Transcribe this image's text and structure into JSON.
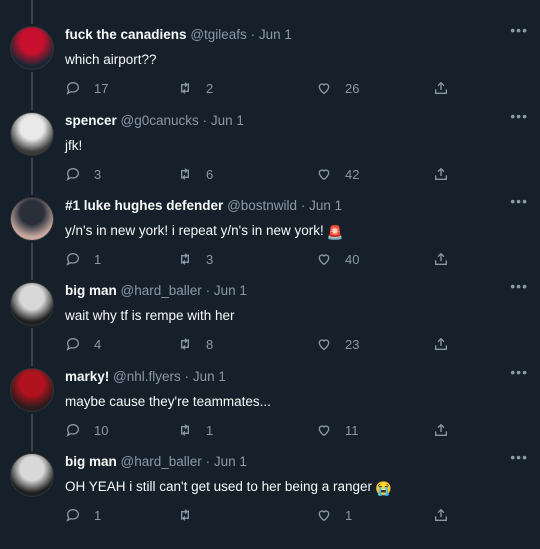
{
  "tweets": [
    {
      "name": "fuck the canadiens",
      "handle": "@tgileafs",
      "date": "Jun 1",
      "text": "which airport??",
      "replies": "17",
      "retweets": "2",
      "likes": "26",
      "avatar_colors": [
        "#c8102e",
        "#1b2633"
      ]
    },
    {
      "name": "spencer",
      "handle": "@g0canucks",
      "date": "Jun 1",
      "text": "jfk!",
      "replies": "3",
      "retweets": "6",
      "likes": "42",
      "avatar_colors": [
        "#e9e9e9",
        "#3a3a3a"
      ]
    },
    {
      "name": "#1 luke hughes defender",
      "handle": "@bostnwild",
      "date": "Jun 1",
      "text": "y/n's in new york! i repeat y/n's in new york!",
      "emoji": "🚨",
      "replies": "1",
      "retweets": "3",
      "likes": "40",
      "avatar_colors": [
        "#2a2f3a",
        "#c8a8a0"
      ]
    },
    {
      "name": "big man",
      "handle": "@hard_baller",
      "date": "Jun 1",
      "text": "wait why tf is rempe with her",
      "replies": "4",
      "retweets": "8",
      "likes": "23",
      "avatar_colors": [
        "#d8d8d8",
        "#1f1f1f"
      ]
    },
    {
      "name": "marky!",
      "handle": "@nhl.flyers",
      "date": "Jun 1",
      "text": "maybe cause they're teammates...",
      "replies": "10",
      "retweets": "1",
      "likes": "11",
      "avatar_colors": [
        "#b0121f",
        "#2b1c1a"
      ]
    },
    {
      "name": "big man",
      "handle": "@hard_baller",
      "date": "Jun 1",
      "text": "OH YEAH i still can't get used to her being a ranger",
      "emoji": "😭",
      "replies": "1",
      "retweets": "",
      "likes": "1",
      "avatar_colors": [
        "#d8d8d8",
        "#1f1f1f"
      ]
    }
  ],
  "more_label": "•••",
  "separator": "·",
  "icons": {
    "reply": "reply-icon",
    "retweet": "retweet-icon",
    "like": "heart-icon",
    "share": "share-icon"
  }
}
